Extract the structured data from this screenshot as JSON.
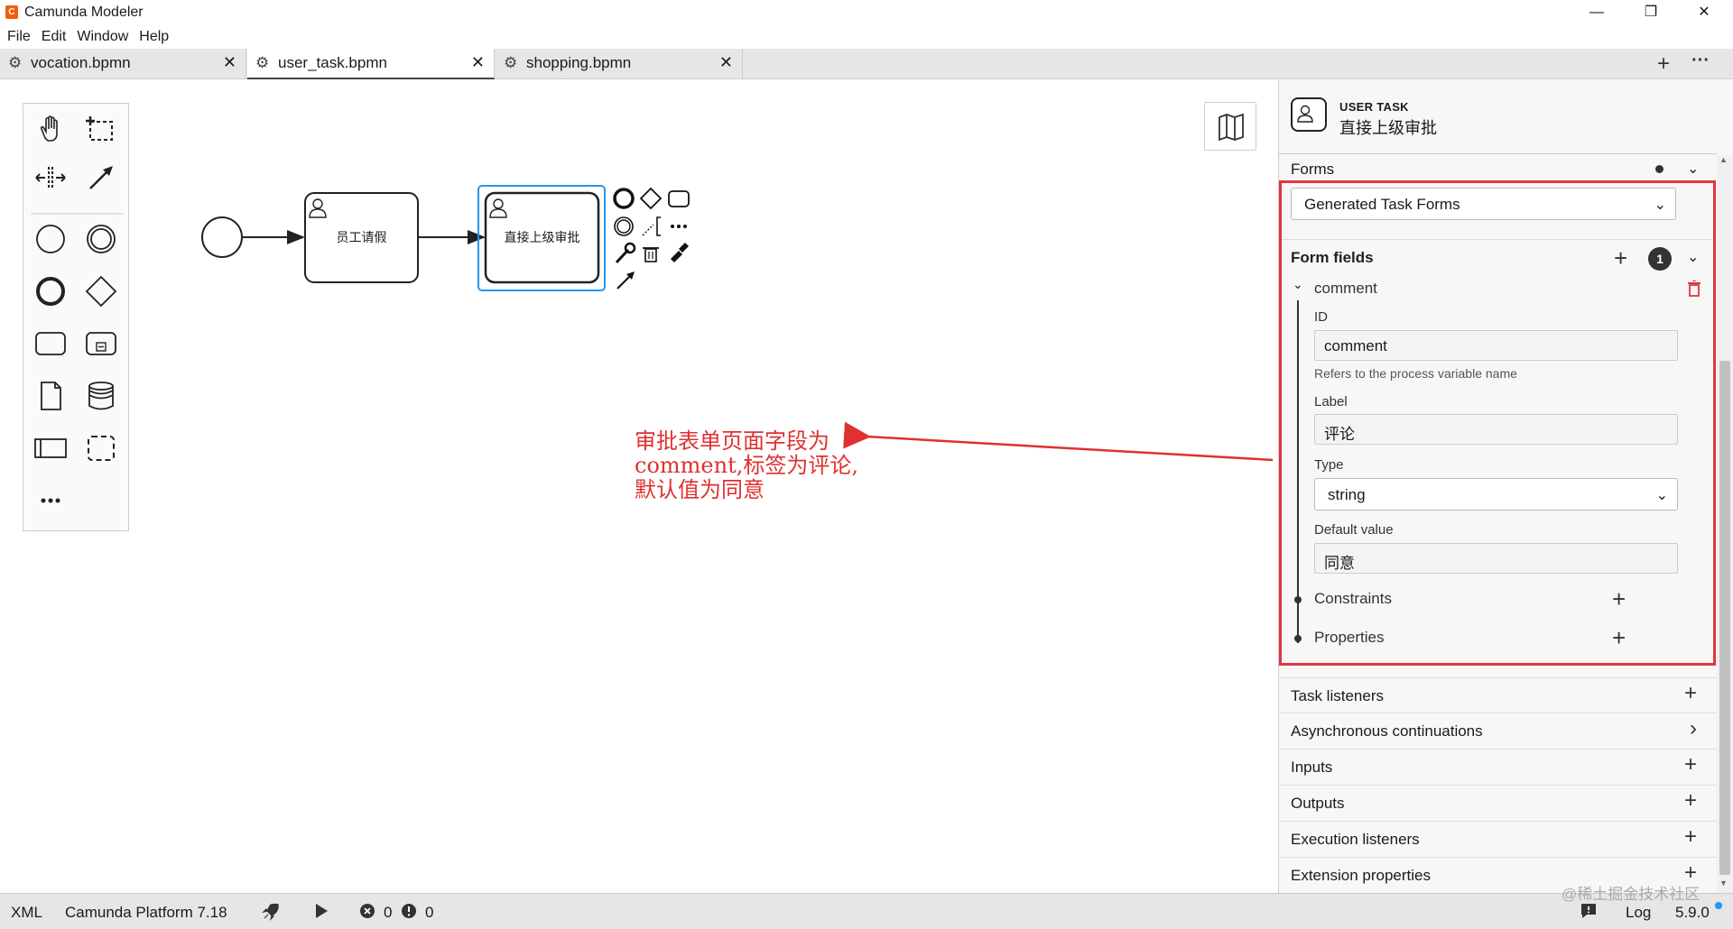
{
  "app": {
    "title": "Camunda Modeler",
    "icon_color": "#f25c05"
  },
  "window_controls": [
    "—",
    "❐",
    "✕"
  ],
  "menu": [
    "File",
    "Edit",
    "Window",
    "Help"
  ],
  "tabs": [
    {
      "name": "vocation.bpmn",
      "close": "✕"
    },
    {
      "name": "user_task.bpmn",
      "close": "✕"
    },
    {
      "name": "shopping.bpmn",
      "close": "✕"
    }
  ],
  "tab_actions": {
    "add": "+",
    "more": "···"
  },
  "diagram": {
    "task1": "员工请假",
    "task2": "直接上级审批",
    "selection_color": "#2196f3"
  },
  "annotation": {
    "text": "审批表单页面字段为\ncomment,标签为评论,\n默认值为同意",
    "color": "#e03030"
  },
  "panel": {
    "element_type": "USER TASK",
    "element_name": "直接上级审批",
    "forms_title": "Forms",
    "form_type": "Generated Task Forms",
    "form_fields_title": "Form fields",
    "form_fields_count": "1",
    "field_name": "comment",
    "id_label": "ID",
    "id_value": "comment",
    "id_hint": "Refers to the process variable name",
    "label_label": "Label",
    "label_value": "评论",
    "type_label": "Type",
    "type_value": "string",
    "default_label": "Default value",
    "default_value": "同意",
    "constraints": "Constraints",
    "properties": "Properties",
    "highlight_color": "#e03541",
    "groups": [
      {
        "title": "Task listeners",
        "action": "+"
      },
      {
        "title": "Asynchronous continuations",
        "action": "›"
      },
      {
        "title": "Inputs",
        "action": "+"
      },
      {
        "title": "Outputs",
        "action": "+"
      },
      {
        "title": "Execution listeners",
        "action": "+"
      },
      {
        "title": "Extension properties",
        "action": "+"
      }
    ]
  },
  "status": {
    "xml": "XML",
    "platform": "Camunda Platform 7.18",
    "errors": "0",
    "warnings": "0",
    "log": "Log",
    "version": "5.9.0",
    "watermark": "@稀土掘金技术社区"
  }
}
